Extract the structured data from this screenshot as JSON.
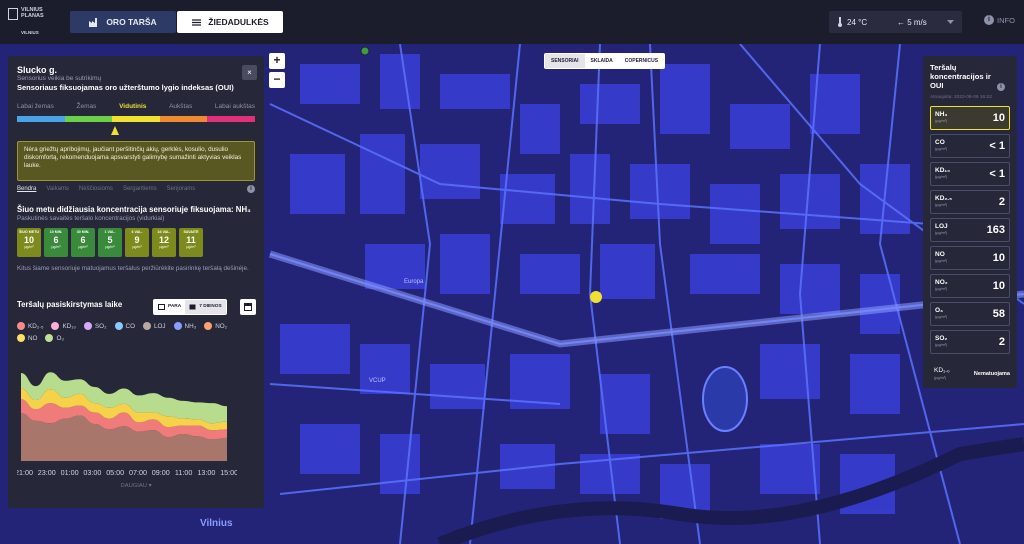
{
  "header": {
    "logo_line1": "VILNIUS",
    "logo_line2": "PLANAS",
    "logo_line3": "VILNIUS",
    "tab_air": "ORO TARŠA",
    "tab_pollen": "ŽIEDADULKĖS",
    "temperature": "24 °C",
    "wind": "← 5 m/s",
    "info": "INFO",
    "colors": {
      "bar": "#1c1d2c",
      "tab_active": "#2e3a66"
    }
  },
  "map": {
    "zoom_in": "+",
    "zoom_out": "−",
    "source_tabs": [
      "SENSORIAI",
      "SKLAIDA",
      "COPERNICUS"
    ],
    "labels": [
      "Europa",
      "VCUP",
      "Vilnius"
    ],
    "colors": {
      "background": "#232478",
      "roads": "#5b72ff",
      "blocks": "#3a3fd6",
      "sensor": "#f0e030"
    }
  },
  "panel": {
    "title": "Slucko g.",
    "subtitle": "Sensorius veikia be sutrikimų",
    "index_title": "Sensoriaus fiksuojamas oro užterštumo lygio indeksas (OUI)",
    "close": "×",
    "levels": [
      {
        "label": "Labai žemas",
        "color": "#4aa3e8"
      },
      {
        "label": "Žemas",
        "color": "#6ccf4a"
      },
      {
        "label": "Vidutinis",
        "color": "#f0e030"
      },
      {
        "label": "Aukštas",
        "color": "#f08a30"
      },
      {
        "label": "Labai aukštas",
        "color": "#e0307a"
      }
    ],
    "advice": "Nėra griežtų apribojimų, jaučiant peršitinčių akių, gerklės, kosulio, dusulio diskomfortą, rekomenduojama apsvarstyti galimybę sumažinti aktyvias veiklas lauke.",
    "groups": [
      "Bendra",
      "Vaikams",
      "Nėščiosioms",
      "Sergantiems",
      "Senjorams"
    ],
    "info_icon": "i",
    "concentration_title": "Šiuo metu didžiausia koncentracija sensoriuje fiksuojama: NH₃",
    "concentration_sub": "Paskutinės savaitės teršalo koncentracijos (vidurkiai)",
    "tiles": [
      {
        "label": "ŠIUO METU",
        "value": "10",
        "unit": "µg/m³",
        "color": "#7d8a1c"
      },
      {
        "label": "10 MIN.",
        "value": "6",
        "unit": "µg/m³",
        "color": "#3a8a3c"
      },
      {
        "label": "30 MIN.",
        "value": "6",
        "unit": "µg/m³",
        "color": "#3a8a3c"
      },
      {
        "label": "1 VAL.",
        "value": "5",
        "unit": "µg/m³",
        "color": "#3a8a3c"
      },
      {
        "label": "6 VAL.",
        "value": "9",
        "unit": "µg/m³",
        "color": "#7d8a1c"
      },
      {
        "label": "24 VAL.",
        "value": "12",
        "unit": "µg/m³",
        "color": "#7d8a1c"
      },
      {
        "label": "SAVAITĖ",
        "value": "11",
        "unit": "µg/m³",
        "color": "#7d8a1c"
      }
    ],
    "tiles_note": "Kitus šiame sensoriuje matuojamus teršalus peržiūrėkite pasirinkę teršalą dešinėje.",
    "chart_title": "Teršalų pasiskirstymas laike",
    "range_day": "PARA",
    "range_week": "7 DIENOS",
    "more": "DAUGIAU"
  },
  "chart_data": {
    "type": "area",
    "title": "Teršalų pasiskirstymas laike",
    "x": [
      "21:00",
      "23:00",
      "01:00",
      "03:00",
      "05:00",
      "07:00",
      "09:00",
      "11:00",
      "13:00",
      "15:00"
    ],
    "legend": [
      "KD₂.₅",
      "KD₁₀",
      "SO₂",
      "CO",
      "LOJ",
      "NH₃",
      "NO₂",
      "NO",
      "O₃"
    ],
    "legend_colors": [
      "#ff8a8a",
      "#ffb0d8",
      "#d8a8ff",
      "#8ac8ff",
      "#b8a8a0",
      "#8a9cff",
      "#ffa070",
      "#ffe066",
      "#bfe09a"
    ],
    "series": [
      {
        "name": "KD₁₀",
        "color": "#a8766a",
        "values": [
          62,
          52,
          49,
          55,
          59,
          48,
          41,
          45,
          38,
          40,
          31,
          35,
          32,
          28,
          30
        ]
      },
      {
        "name": "KD₂.₅",
        "color": "#f07b7b",
        "values": [
          18,
          15,
          26,
          14,
          13,
          15,
          14,
          18,
          12,
          14,
          13,
          11,
          14,
          12,
          11
        ]
      },
      {
        "name": "NO",
        "color": "#f6d24a",
        "values": [
          14,
          12,
          18,
          13,
          15,
          12,
          14,
          11,
          13,
          9,
          14,
          9,
          8,
          9,
          10
        ]
      },
      {
        "name": "O₃",
        "color": "#b8dc8e",
        "values": [
          20,
          18,
          22,
          22,
          19,
          21,
          18,
          20,
          22,
          25,
          24,
          23,
          22,
          26,
          20
        ]
      }
    ]
  },
  "right": {
    "title": "Teršalų koncentracijos ir OUI",
    "info_icon": "i",
    "updated": "Atnaujinta: 2023-08-09 16:22",
    "unit": "(µg/m³)",
    "rows": [
      {
        "name": "NH₃",
        "value": "10"
      },
      {
        "name": "CO",
        "value": "< 1"
      },
      {
        "name": "KD₁₀",
        "value": "< 1"
      },
      {
        "name": "KD₂.₅",
        "value": "2"
      },
      {
        "name": "LOJ",
        "value": "163"
      },
      {
        "name": "NO",
        "value": "10"
      },
      {
        "name": "NO₂",
        "value": "10"
      },
      {
        "name": "O₃",
        "value": "58"
      },
      {
        "name": "SO₂",
        "value": "2"
      }
    ],
    "not_measured_name": "KD₁.₀",
    "not_measured_value": "Nematuojama"
  }
}
